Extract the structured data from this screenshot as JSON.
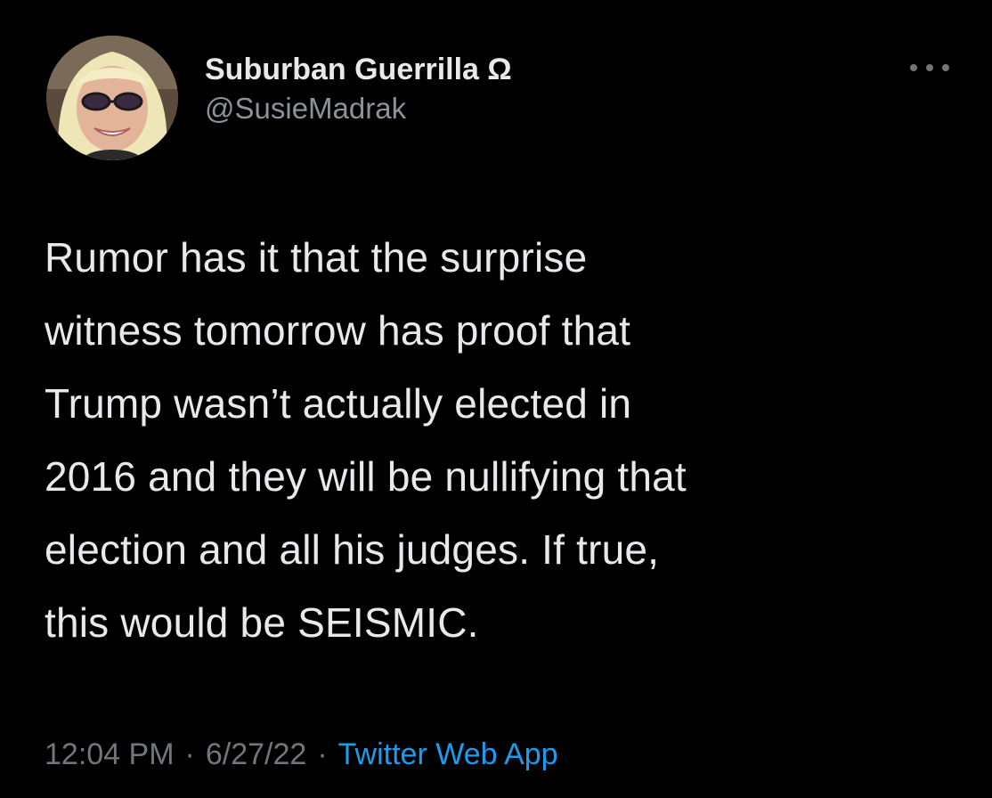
{
  "user": {
    "display_name": "Suburban Guerrilla Ω",
    "handle": "@SusieMadrak",
    "avatar": "profile-photo"
  },
  "more_icon": "more-horizontal-icon",
  "tweet": {
    "lines": [
      "Rumor has it that the surprise",
      "witness tomorrow has proof that",
      "Trump wasn’t actually elected in",
      "2016 and they will be nullifying that",
      "election and all his judges. If true,",
      "this would be SEISMIC."
    ]
  },
  "meta": {
    "time": "12:04 PM",
    "separator": "·",
    "date": "6/27/22",
    "source": "Twitter Web App"
  },
  "colors": {
    "background": "#000000",
    "primary_text": "#e7e9ea",
    "secondary_text": "#71767b",
    "link": "#1d9bf0"
  }
}
